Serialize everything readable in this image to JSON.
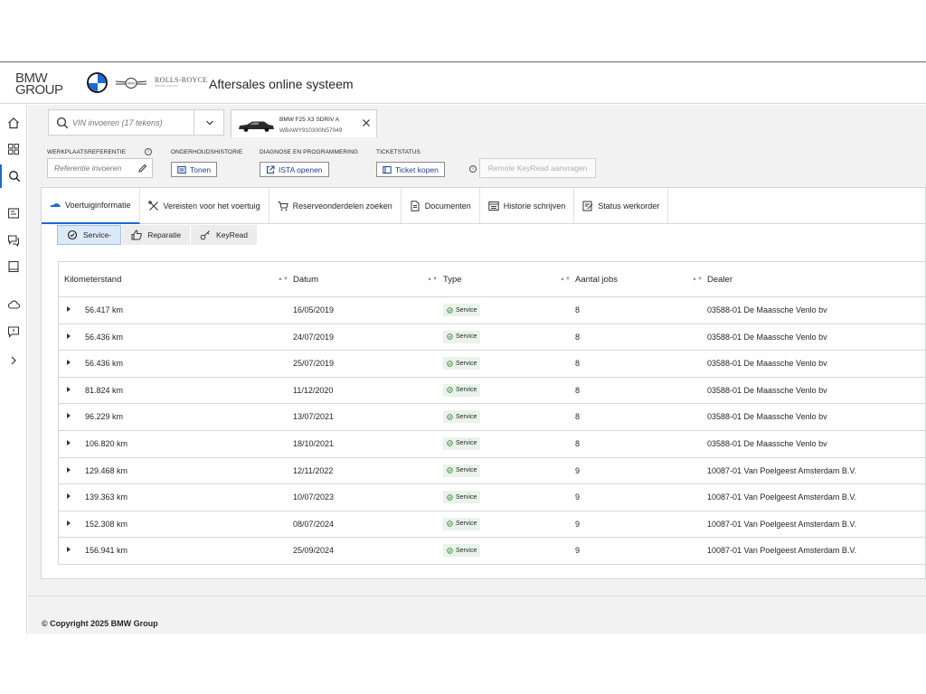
{
  "header": {
    "group_line1": "BMW",
    "group_line2": "GROUP",
    "rolls_royce": "ROLLS-ROYCE",
    "rolls_royce_sub": "MOTOR CARS LTD",
    "app_title": "Aftersales online systeem"
  },
  "nav": {
    "icons": [
      "home-icon",
      "dashboard-icon",
      "search-icon",
      "service-icon",
      "chat-icon",
      "book-icon",
      "cloud-icon",
      "feedback-icon",
      "expand-icon"
    ]
  },
  "search": {
    "vin_placeholder": "VIN invoeren (17 tekens)"
  },
  "vehicle_tab": {
    "name": "BMW F25 X3 SDRIV A",
    "vin": "WBAWY910300N57049"
  },
  "actions": {
    "workshop_ref_label": "WERKPLAATSREFERENTIE",
    "workshop_ref_placeholder": "Referentie invoeren",
    "maintenance_label": "ONDERHOUDSHISTORIE",
    "maintenance_button": "Tonen",
    "diagnosis_label": "DIAGNOSE EN PROGRAMMERING",
    "diagnosis_button": "ISTA openen",
    "ticket_label": "TICKETSTATUS",
    "ticket_button": "Ticket kopen",
    "remote_keyread": "Remote KeyRead aanvragen"
  },
  "main_tabs": [
    {
      "label": "Voertuiginformatie",
      "icon": "car-icon",
      "active": true
    },
    {
      "label": "Vereisten voor het voertuig",
      "icon": "tools-icon",
      "active": false
    },
    {
      "label": "Reserveonderdelen zoeken",
      "icon": "cart-icon",
      "active": false
    },
    {
      "label": "Documenten",
      "icon": "document-icon",
      "active": false
    },
    {
      "label": "Historie schrijven",
      "icon": "history-icon",
      "active": false
    },
    {
      "label": "Status werkorder",
      "icon": "workorder-icon",
      "active": false
    }
  ],
  "sub_tabs": [
    {
      "label": "Service-",
      "icon": "service-gear-icon",
      "active": true
    },
    {
      "label": "Reparatie",
      "icon": "thumb-icon",
      "active": false
    },
    {
      "label": "KeyRead",
      "icon": "key-icon",
      "active": false
    }
  ],
  "table": {
    "columns": [
      "Kilometerstand",
      "Datum",
      "Type",
      "Aantal jobs",
      "Dealer"
    ],
    "rows": [
      {
        "km": "56.417 km",
        "date": "16/05/2019",
        "type": "Service",
        "jobs": "8",
        "dealer": "03588-01 De Maassche Venlo bv"
      },
      {
        "km": "56.436 km",
        "date": "24/07/2019",
        "type": "Service",
        "jobs": "8",
        "dealer": "03588-01 De Maassche Venlo bv"
      },
      {
        "km": "56.436 km",
        "date": "25/07/2019",
        "type": "Service",
        "jobs": "8",
        "dealer": "03588-01 De Maassche Venlo bv"
      },
      {
        "km": "81.824 km",
        "date": "11/12/2020",
        "type": "Service",
        "jobs": "8",
        "dealer": "03588-01 De Maassche Venlo bv"
      },
      {
        "km": "96.229 km",
        "date": "13/07/2021",
        "type": "Service",
        "jobs": "8",
        "dealer": "03588-01 De Maassche Venlo bv"
      },
      {
        "km": "106.820 km",
        "date": "18/10/2021",
        "type": "Service",
        "jobs": "8",
        "dealer": "03588-01 De Maassche Venlo bv"
      },
      {
        "km": "129.468 km",
        "date": "12/11/2022",
        "type": "Service",
        "jobs": "9",
        "dealer": "10087-01 Van Poelgeest Amsterdam B.V."
      },
      {
        "km": "139.363 km",
        "date": "10/07/2023",
        "type": "Service",
        "jobs": "9",
        "dealer": "10087-01 Van Poelgeest Amsterdam B.V."
      },
      {
        "km": "152.308 km",
        "date": "08/07/2024",
        "type": "Service",
        "jobs": "9",
        "dealer": "10087-01 Van Poelgeest Amsterdam B.V."
      },
      {
        "km": "156.941 km",
        "date": "25/09/2024",
        "type": "Service",
        "jobs": "9",
        "dealer": "10087-01 Van Poelgeest Amsterdam B.V."
      }
    ]
  },
  "footer": {
    "copyright": "© Copyright 2025 BMW Group"
  },
  "colors": {
    "accent": "#1c69d4",
    "button_text": "#1c3f94",
    "badge_bg": "#e9f3ea",
    "badge_icon": "#2e7d32"
  }
}
